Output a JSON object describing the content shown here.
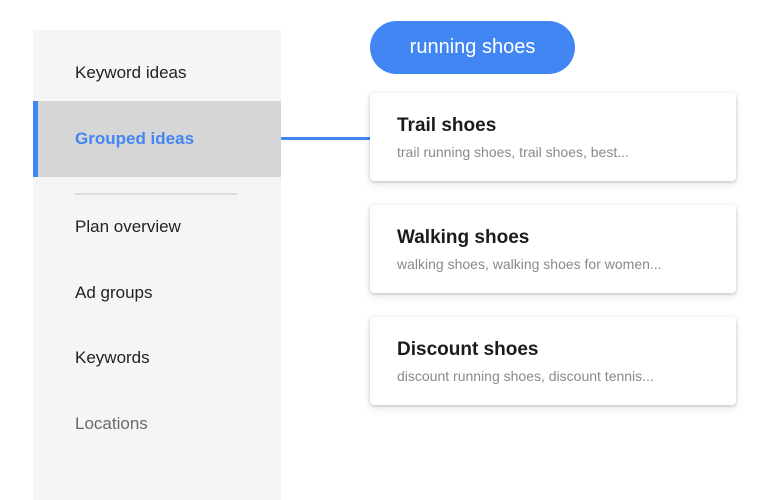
{
  "sidebar": {
    "items": [
      {
        "label": "Keyword ideas"
      },
      {
        "label": "Grouped ideas"
      },
      {
        "label": "Plan overview"
      },
      {
        "label": "Ad groups"
      },
      {
        "label": "Keywords"
      },
      {
        "label": "Locations"
      }
    ],
    "active_index": 1
  },
  "search_chip": {
    "label": "running shoes"
  },
  "cards": [
    {
      "title": "Trail shoes",
      "description": "trail running shoes, trail shoes, best..."
    },
    {
      "title": "Walking shoes",
      "description": "walking shoes, walking shoes for women..."
    },
    {
      "title": "Discount shoes",
      "description": "discount running shoes, discount tennis..."
    }
  ],
  "colors": {
    "accent": "#4286f4",
    "sidebar_bg": "#f5f5f5",
    "active_bg": "#d6d6d6"
  }
}
